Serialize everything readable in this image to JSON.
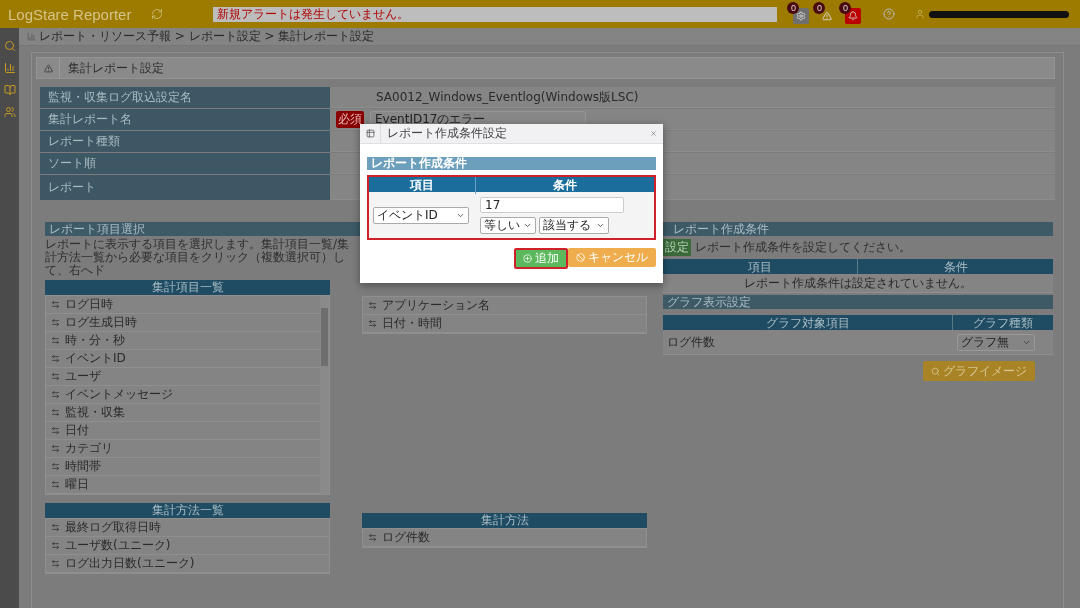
{
  "header": {
    "app_title": "LogStare Reporter",
    "alert": "新規アラートは発生していません。",
    "counters": [
      {
        "kind": "settings",
        "count": "0"
      },
      {
        "kind": "warning",
        "count": "0"
      },
      {
        "kind": "alarm",
        "count": "0"
      }
    ]
  },
  "breadcrumb": "レポート・リソース予報 > レポート設定 > 集計レポート設定",
  "panel": {
    "title": "集計レポート設定"
  },
  "form": [
    {
      "label": "監視・収集ログ取込設定名",
      "kind": "text",
      "value": "SA0012_Windows_Eventlog(Windows版LSC)"
    },
    {
      "label": "集計レポート名",
      "kind": "input",
      "badge": "必須",
      "value": "EventID17のエラー"
    },
    {
      "label": "レポート種類",
      "kind": "empty"
    },
    {
      "label": "ソート順",
      "kind": "empty"
    },
    {
      "label": "レポート",
      "kind": "empty"
    }
  ],
  "item_selection": {
    "title": "レポート項目選択",
    "hint": "レポートに表示する項目を選択します。集計項目一覧/集計方法一覧から必要な項目をクリック（複数選択可）して、右へド",
    "item_list": {
      "title": "集計項目一覧",
      "items": [
        "ログ日時",
        "ログ生成日時",
        "時・分・秒",
        "イベントID",
        "ユーザ",
        "イベントメッセージ",
        "監視・収集",
        "日付",
        "カテゴリ",
        "時間帯",
        "曜日"
      ]
    },
    "selected_items": [
      "アプリケーション名",
      "日付・時間"
    ],
    "method_list": {
      "title": "集計方法一覧",
      "items": [
        "最終ログ取得日時",
        "ユーザ数(ユニーク)",
        "ログ出力日数(ユニーク)"
      ]
    },
    "selected_methods": {
      "title": "集計方法",
      "items": [
        "ログ件数"
      ]
    }
  },
  "conditions": {
    "title": "レポート作成条件",
    "set_button": "設定",
    "message": "レポート作成条件を設定してください。",
    "columns": [
      "項目",
      "条件"
    ],
    "empty": "レポート作成条件は設定されていません。"
  },
  "graph": {
    "title": "グラフ表示設定",
    "columns": [
      "グラフ対象項目",
      "グラフ種類"
    ],
    "rows": [
      {
        "item": "ログ件数",
        "type": "グラフ無"
      }
    ],
    "preview_button": "グラフイメージ"
  },
  "modal": {
    "title": "レポート作成条件設定",
    "section": "レポート作成条件",
    "columns": [
      "項目",
      "条件"
    ],
    "highlighted": true,
    "field": "イベントID",
    "value": "17",
    "operator": "等しい",
    "match": "該当する",
    "buttons": [
      {
        "kind": "add",
        "label": "追加",
        "highlighted": true
      },
      {
        "kind": "cancel",
        "label": "キャンセル",
        "highlighted": false
      }
    ]
  }
}
